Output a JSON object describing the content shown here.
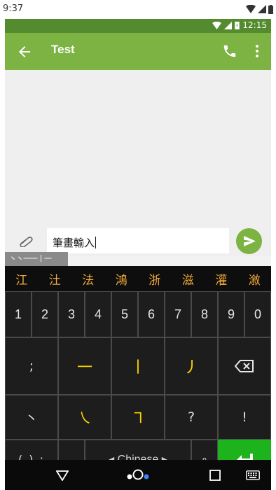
{
  "host_status": {
    "time": "9:37"
  },
  "status_bar": {
    "time": "12:15"
  },
  "app_bar": {
    "title": "Test"
  },
  "compose": {
    "text": "筆畫輸入"
  },
  "stroke_input": {
    "strokes": "丶丶一一丨一"
  },
  "candidates": [
    "江",
    "汢",
    "法",
    "鴻",
    "浙",
    "滋",
    "灌",
    "漵"
  ],
  "keyboard": {
    "numbers": [
      "1",
      "2",
      "3",
      "4",
      "5",
      "6",
      "7",
      "8",
      "9",
      "0"
    ],
    "row2": {
      "semicolon": ";",
      "stroke1": "一",
      "stroke2": "丨",
      "stroke3": "丿"
    },
    "row3": {
      "dot": "丶",
      "stroke4": "㇏",
      "stroke5": "㇕",
      "question": "?",
      "exclaim": "!"
    },
    "row4": {
      "paren": "( ) :",
      "comma": ",",
      "space_label": "◂ Chinese ▸",
      "circle": "∘"
    }
  },
  "colors": {
    "app_bar": "#7cb342",
    "status": "#558b2f",
    "candidate": "#f0a83a",
    "stroke_key": "#ffd400",
    "enter": "#1db31d"
  }
}
